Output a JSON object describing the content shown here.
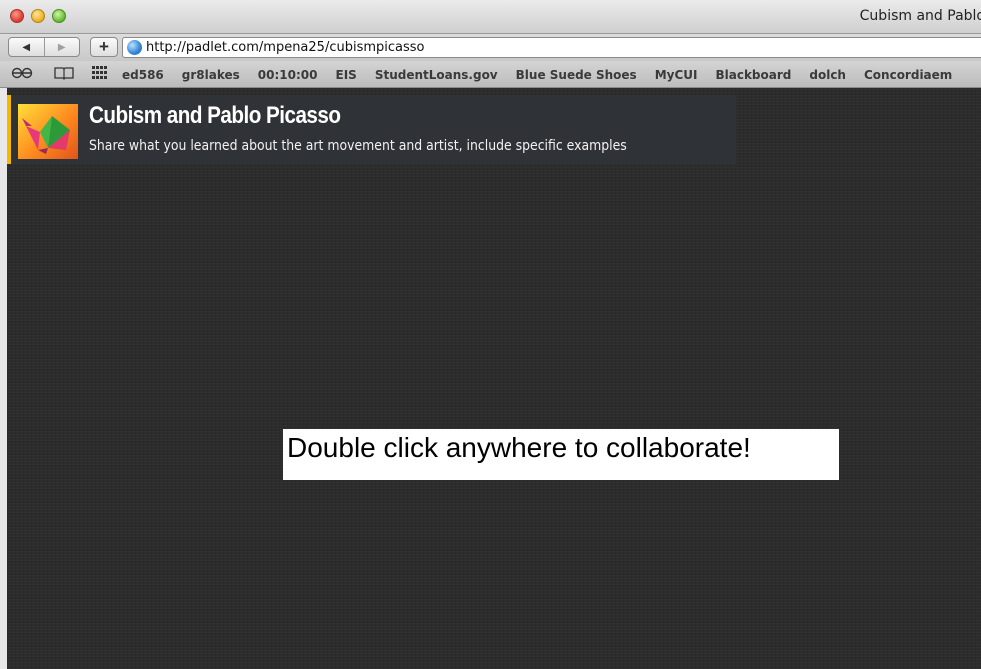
{
  "window": {
    "title": "Cubism and Pablo"
  },
  "toolbar": {
    "back_icon": "◀",
    "forward_icon": "▶",
    "add_icon": "+",
    "url": "http://padlet.com/mpena25/cubismpicasso"
  },
  "bookmarks": {
    "reading_icon": "⊖⊖",
    "book_icon": "📖",
    "grid_icon": "▦",
    "items": [
      "ed586",
      "gr8lakes",
      "00:10:00",
      "EIS",
      "StudentLoans.gov",
      "Blue Suede Shoes",
      "MyCUI",
      "Blackboard",
      "dolch",
      "Concordiaem"
    ]
  },
  "padlet": {
    "title": "Cubism and Pablo Picasso",
    "subtitle": "Share what you learned about the art movement and artist, include specific examples",
    "hint": "Double click anywhere to collaborate!",
    "accent_color": "#f5b800",
    "header_color": "#2f3237"
  }
}
